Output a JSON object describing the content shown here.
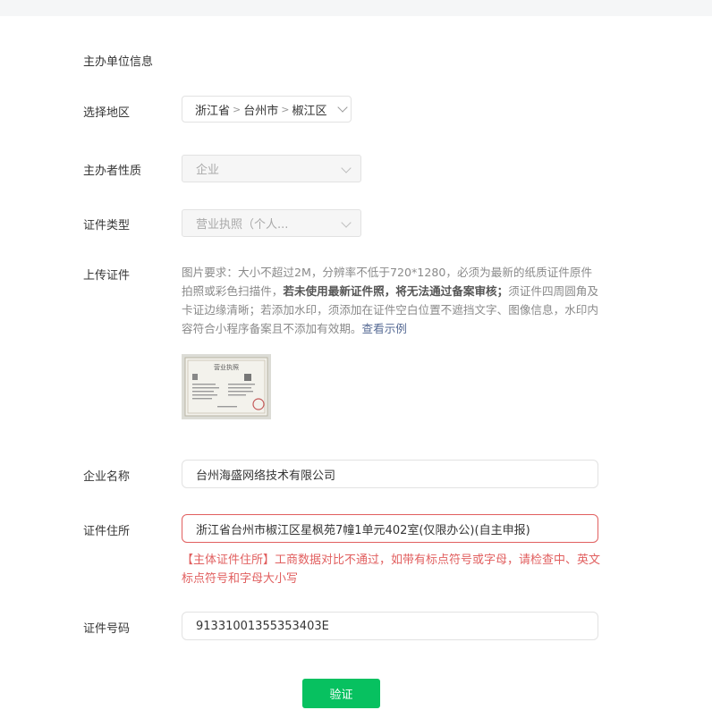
{
  "section": {
    "title": "主办单位信息"
  },
  "region": {
    "label": "选择地区",
    "province": "浙江省",
    "city": "台州市",
    "district": "椒江区",
    "separator": ">"
  },
  "organizer_type": {
    "label": "主办者性质",
    "value": "企业"
  },
  "certificate_type": {
    "label": "证件类型",
    "value": "营业执照（个人..."
  },
  "upload": {
    "label": "上传证件",
    "desc_part1": "图片要求：大小不超过2M，分辨率不低于720*1280，必须为最新的纸质证件原件拍照或彩色扫描件，",
    "desc_bold": "若未使用最新证件照，将无法通过备案审核；",
    "desc_part2": "须证件四周圆角及卡证边缘清晰；若添加水印，须添加在证件空白位置不遮挡文字、图像信息，水印内容符合小程序备案且不添加有效期。",
    "example_link": "查看示例",
    "thumbnail_heading": "营业执照"
  },
  "company_name": {
    "label": "企业名称",
    "value": "台州海盛网络技术有限公司"
  },
  "cert_address": {
    "label": "证件住所",
    "value": "浙江省台州市椒江区星枫苑7幢1单元402室(仅限办公)(自主申报)",
    "error": "【主体证件住所】工商数据对比不通过，如带有标点符号或字母，请检查中、英文标点符号和字母大小写"
  },
  "cert_number": {
    "label": "证件号码",
    "value": "91331001355353403E"
  },
  "verify_button": {
    "label": "验证"
  },
  "colors": {
    "primary": "#07c160",
    "error": "#e15f5f",
    "link": "#576b95"
  }
}
